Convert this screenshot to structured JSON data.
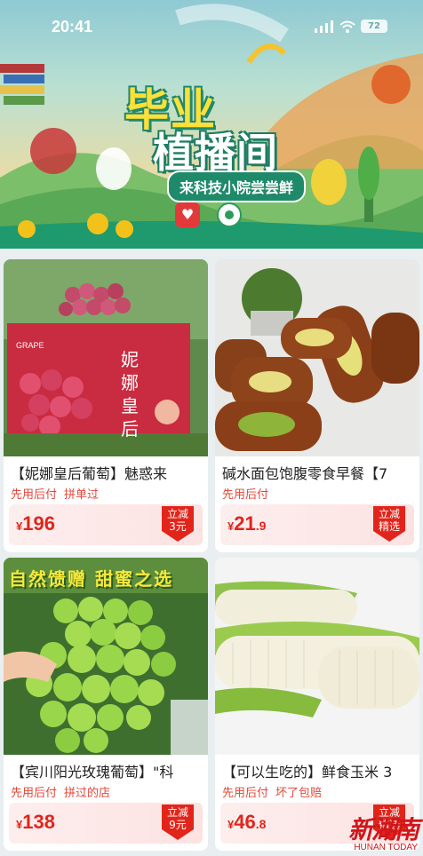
{
  "status_bar": {
    "time": "20:41",
    "battery": "72"
  },
  "banner": {
    "headline_line1": "毕业",
    "headline_line2": "植播间",
    "subtitle": "来科技小院尝尝鲜"
  },
  "products": [
    {
      "title": "【妮娜皇后葡萄】魅惑来",
      "tags": [
        "先用后付",
        "拼单过"
      ],
      "price_symbol": "¥",
      "price_int": "196",
      "price_dec": "",
      "discount_line1": "立减",
      "discount_line2": "3元",
      "image_text": "妮娜皇后",
      "image_label": "GRAPE"
    },
    {
      "title": "碱水面包饱腹零食早餐【7",
      "tags": [
        "先用后付"
      ],
      "price_symbol": "¥",
      "price_int": "21",
      "price_dec": ".9",
      "discount_line1": "立减",
      "discount_line2": "精选"
    },
    {
      "title": "【宾川阳光玫瑰葡萄】\"科",
      "tags": [
        "先用后付",
        "拼过的店"
      ],
      "price_symbol": "¥",
      "price_int": "138",
      "price_dec": "",
      "discount_line1": "立减",
      "discount_line2": "9元",
      "image_text": "自然馈赠 甜蜜之选"
    },
    {
      "title": "【可以生吃的】鲜食玉米 3",
      "tags": [
        "先用后付",
        "坏了包赔"
      ],
      "price_symbol": "¥",
      "price_int": "46",
      "price_dec": ".8",
      "discount_line1": "立减",
      "discount_line2": "精选"
    }
  ],
  "watermark": {
    "cn": "新湖南",
    "en": "HUNAN TODAY"
  },
  "colors": {
    "price": "#e1251b",
    "tag": "#e3483a",
    "banner_green": "#1f8a6a"
  }
}
